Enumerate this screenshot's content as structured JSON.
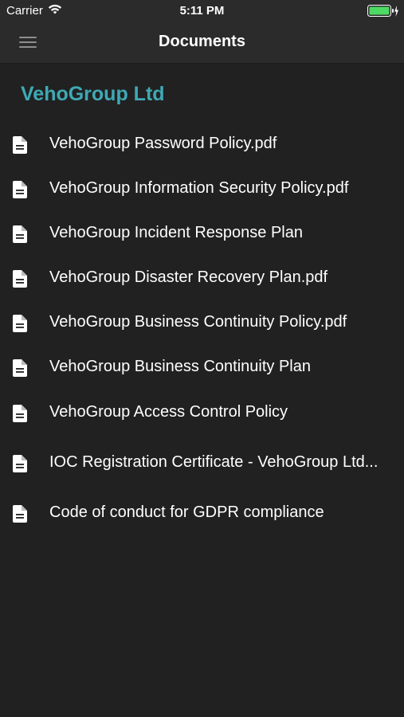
{
  "status_bar": {
    "carrier": "Carrier",
    "time": "5:11 PM",
    "battery_color": "#4cd964"
  },
  "nav": {
    "title": "Documents",
    "menu_icon": "hamburger-menu-icon"
  },
  "company": {
    "name": "VehoGroup Ltd",
    "color": "#3fa9b4"
  },
  "documents": [
    {
      "label": "VehoGroup Password Policy.pdf",
      "icon": "document-icon"
    },
    {
      "label": "VehoGroup Information Security Policy.pdf",
      "icon": "document-icon"
    },
    {
      "label": "VehoGroup Incident Response Plan",
      "icon": "document-icon"
    },
    {
      "label": "VehoGroup Disaster Recovery Plan.pdf",
      "icon": "document-icon"
    },
    {
      "label": "VehoGroup Business Continuity Policy.pdf",
      "icon": "document-icon"
    },
    {
      "label": "VehoGroup Business Continuity Plan",
      "icon": "document-icon"
    },
    {
      "label": "VehoGroup Access Control Policy",
      "icon": "document-icon"
    },
    {
      "label": "IOC Registration Certificate - VehoGroup Ltd...",
      "icon": "document-icon"
    },
    {
      "label": "Code of conduct for GDPR compliance",
      "icon": "document-icon"
    }
  ]
}
